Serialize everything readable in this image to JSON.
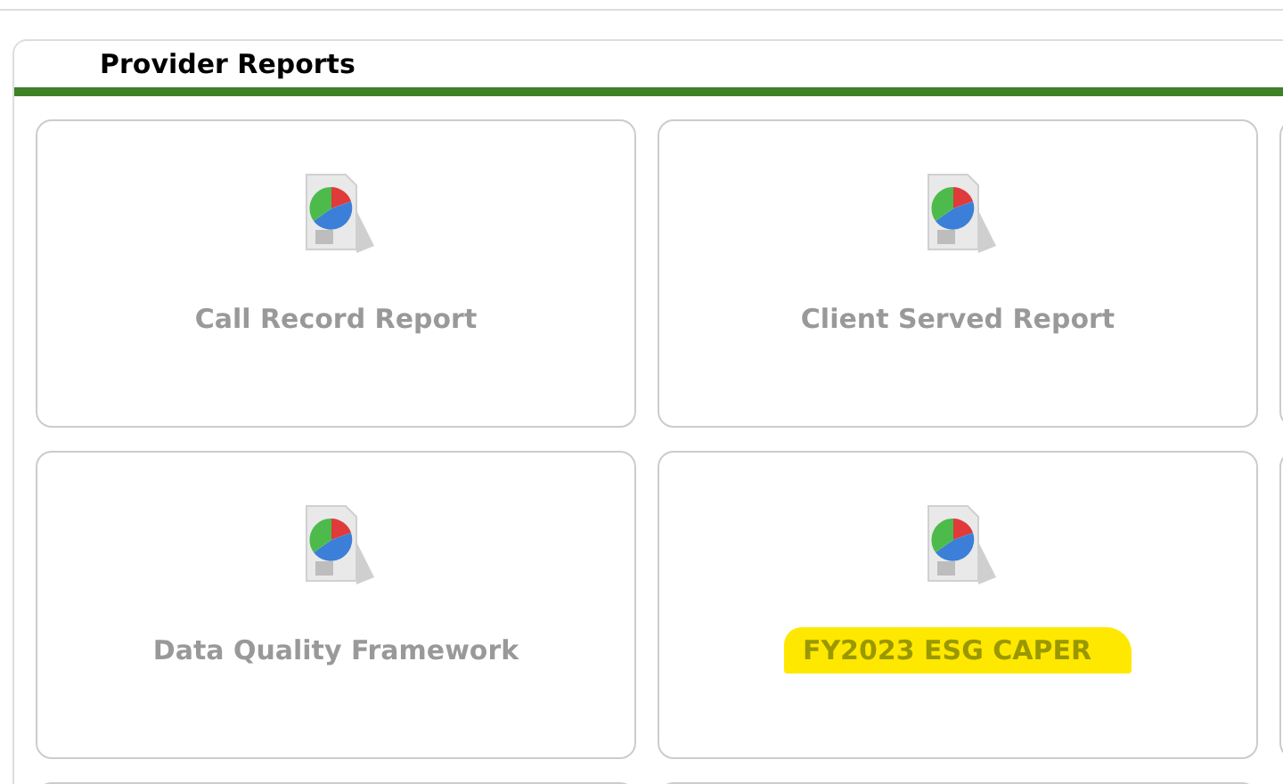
{
  "panel": {
    "title": "Provider Reports"
  },
  "tiles": [
    {
      "title": "Call Record Report",
      "highlighted": false
    },
    {
      "title": "Client Served Report",
      "highlighted": false
    },
    {
      "title": "Data Quality Framework",
      "highlighted": false
    },
    {
      "title": "FY2023 ESG CAPER",
      "highlighted": true
    }
  ]
}
